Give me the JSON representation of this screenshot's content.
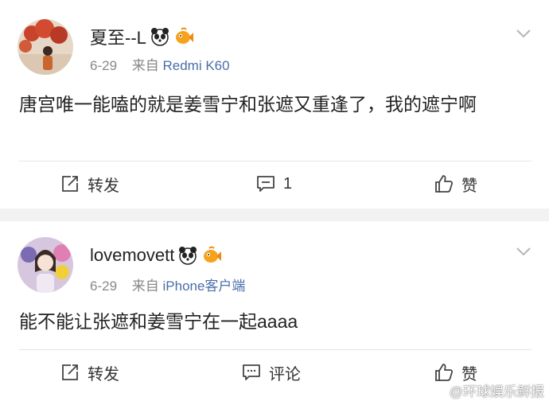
{
  "posts": [
    {
      "username": "夏至--L",
      "badges": [
        "panda-badge-icon",
        "fish-badge-icon"
      ],
      "date": "6-29",
      "source_prefix": "来自",
      "source_device": "Redmi K60",
      "content": "唐宫唯一能嗑的就是姜雪宁和张遮又重逢了，我的遮宁啊",
      "actions": {
        "repost": "转发",
        "comment": "1",
        "like": "赞"
      }
    },
    {
      "username": "lovemovett",
      "badges": [
        "panda-badge-icon",
        "fish-badge-icon"
      ],
      "date": "6-29",
      "source_prefix": "来自",
      "source_device": "iPhone客户端",
      "content": "能不能让张遮和姜雪宁在一起aaaa",
      "actions": {
        "repost": "转发",
        "comment": "评论",
        "like": "赞"
      }
    }
  ],
  "watermark": "@环球娱乐鲜报",
  "colors": {
    "link": "#4a6ea9",
    "meta": "#888888",
    "divider": "#e6e6e6",
    "gap": "#f2f2f2"
  }
}
